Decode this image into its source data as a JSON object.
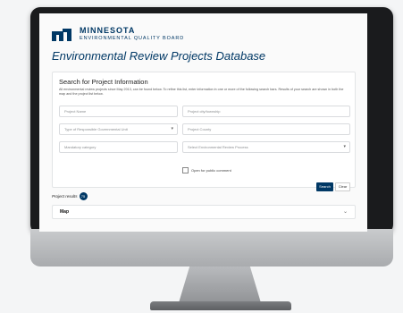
{
  "logo": {
    "line1": "MINNESOTA",
    "line2": "ENVIRONMENTAL QUALITY BOARD",
    "color": "#003865"
  },
  "page_title": "Environmental Review Projects Database",
  "search_panel": {
    "title": "Search for Project Information",
    "description": "All environmental review projects since May 2013, can be found below. To refine this list, enter information in one or more of the following search bars. Results of your search are shown in both the map and the project list below.",
    "fields": {
      "project_name": "Project Name",
      "project_city": "Project city/township",
      "gov_unit": "Type of Responsible Governmental Unit",
      "county": "Project County",
      "mandatory_category": "Mandatory category",
      "review_process": "Select Environmental Review Process"
    },
    "open_comment_label": "Open for public comment",
    "search_label": "Search",
    "clear_label": "Clear"
  },
  "results": {
    "label": "Project results",
    "count": "75"
  },
  "map": {
    "label": "Map"
  }
}
